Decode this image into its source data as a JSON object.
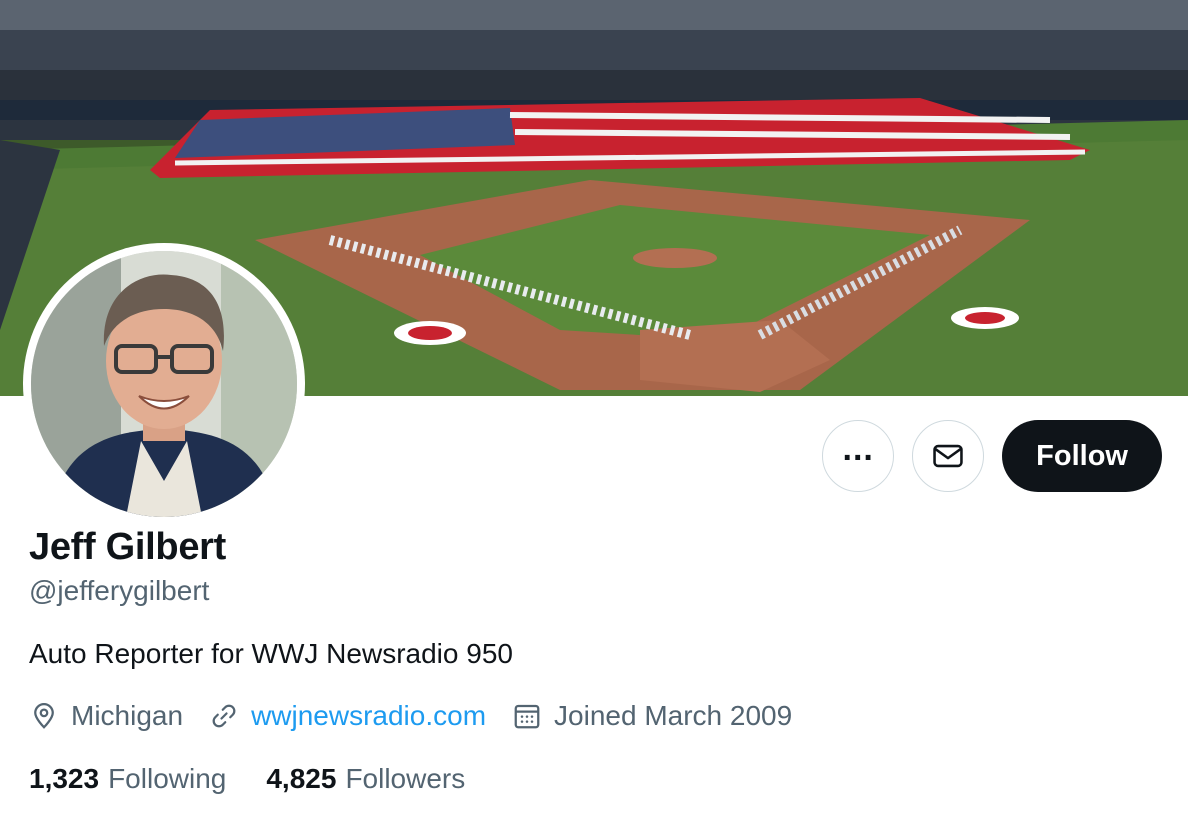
{
  "banner": {
    "description_icon": "ballpark-banner-image"
  },
  "profile": {
    "name": "Jeff Gilbert",
    "handle": "@jefferygilbert",
    "bio": "Auto Reporter for WWJ Newsradio 950",
    "location": "Michigan",
    "website": "wwjnewsradio.com",
    "joined": "Joined March 2009"
  },
  "actions": {
    "more_icon": "more-horizontal-icon",
    "message_icon": "envelope-icon",
    "follow_label": "Follow"
  },
  "stats": {
    "following_count": "1,323",
    "following_label": "Following",
    "followers_count": "4,825",
    "followers_label": "Followers"
  },
  "colors": {
    "link": "#1d9bf0",
    "secondary_text": "#536471",
    "primary_text": "#0f1419",
    "follow_button_bg": "#0f1419"
  }
}
